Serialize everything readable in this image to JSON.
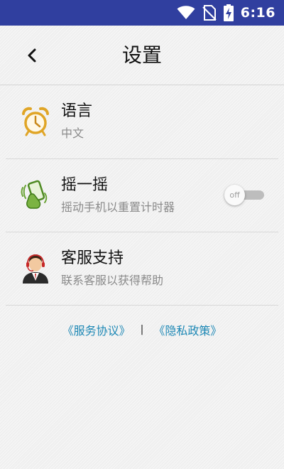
{
  "status_bar": {
    "time": "6:16",
    "icons": [
      "wifi-icon",
      "no-sim-icon",
      "battery-charging-icon"
    ],
    "background": "#303f9f"
  },
  "header": {
    "title": "设置",
    "back_icon": "chevron-left-icon"
  },
  "settings": [
    {
      "icon": "alarm-clock-icon",
      "title": "语言",
      "subtitle": "中文"
    },
    {
      "icon": "shake-phone-icon",
      "title": "摇一摇",
      "subtitle": "摇动手机以重置计时器",
      "toggle": {
        "state_label": "off",
        "on": false
      }
    },
    {
      "icon": "customer-service-icon",
      "title": "客服支持",
      "subtitle": "联系客服以获得帮助"
    }
  ],
  "footer": {
    "terms_label": "《服务协议》",
    "separator": "|",
    "privacy_label": "《隐私政策》",
    "link_color": "#1e88b5"
  }
}
